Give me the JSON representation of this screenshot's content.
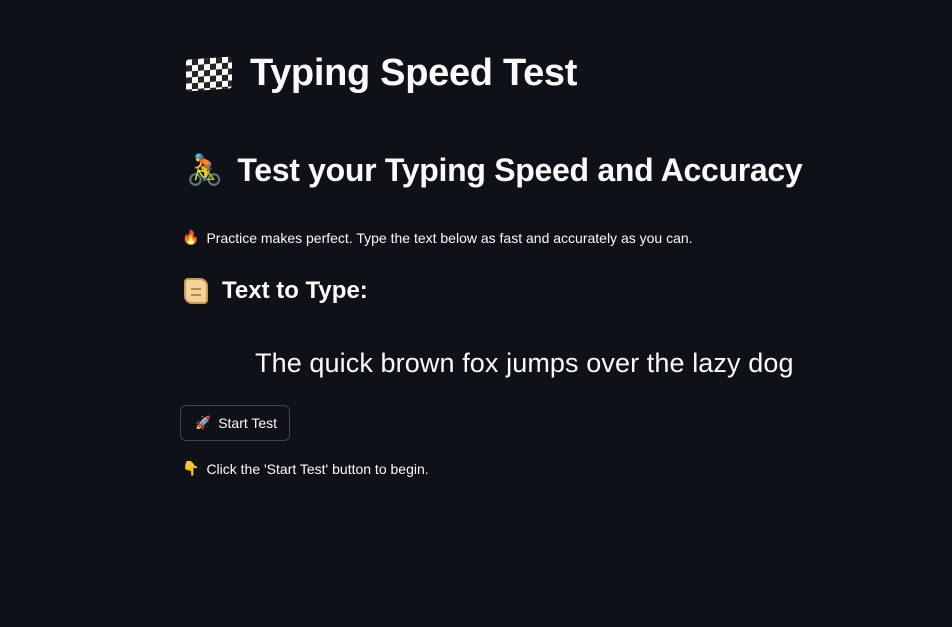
{
  "title": {
    "icon": "checkered-flag-icon",
    "text": "Typing Speed Test"
  },
  "subheader": {
    "icon": "bicyclist-icon",
    "icon_glyph": "🚴",
    "text": "Test your Typing Speed and Accuracy"
  },
  "caption": {
    "icon": "fire-icon",
    "icon_glyph": "🔥",
    "text": "Practice makes perfect. Type the text below as fast and accurately as you can."
  },
  "section": {
    "icon": "scroll-icon",
    "text": "Text to Type:"
  },
  "target_text": "The quick brown fox jumps over the lazy dog",
  "start_button": {
    "icon": "rocket-icon",
    "icon_glyph": "🚀",
    "label": "Start Test"
  },
  "hint": {
    "icon": "pointing-down-icon",
    "icon_glyph": "👇",
    "text": "Click the 'Start Test' button to begin."
  },
  "colors": {
    "background": "#0e1117",
    "text": "#fafafa"
  }
}
